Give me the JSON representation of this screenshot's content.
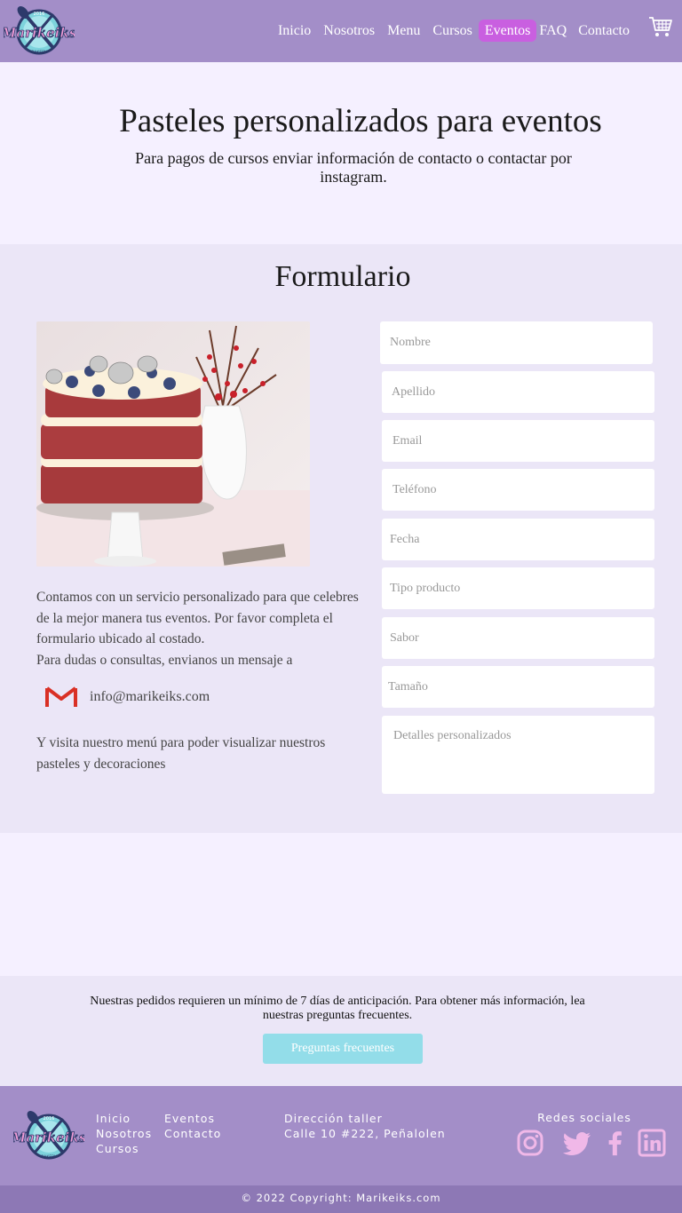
{
  "header": {
    "logo_text": "Marikeiks",
    "logo_year": "2016",
    "logo_sub": "BAKERY",
    "nav": [
      {
        "label": "Inicio",
        "active": false
      },
      {
        "label": "Nosotros",
        "active": false
      },
      {
        "label": "Menu",
        "active": false
      },
      {
        "label": "Cursos",
        "active": false
      },
      {
        "label": "Eventos",
        "active": true
      },
      {
        "label": "FAQ",
        "active": false
      },
      {
        "label": "Contacto",
        "active": false
      }
    ],
    "cart_icon": "shopping-cart-icon"
  },
  "hero": {
    "title": "Pasteles personalizados para eventos",
    "subtitle": "Para pagos de cursos enviar información de contacto o contactar por instagram."
  },
  "form_section": {
    "title": "Formulario",
    "info_text": "Contamos con un servicio personalizado para que celebres de la mejor manera tus eventos. Por favor completa el formulario ubicado al costado.",
    "info_text_2": "Para dudas o consultas, envianos un mensaje a",
    "email": "info@marikeiks.com",
    "menu_text": "Y visita nuestro menú para poder visualizar nuestros pasteles y decoraciones",
    "fields": {
      "nombre": "Nombre",
      "apellido": "Apellido",
      "email": "Email",
      "telefono": "Teléfono",
      "fecha": "Fecha",
      "tipo_producto": "Tipo producto",
      "sabor": "Sabor",
      "tamano": "Tamaño",
      "detalles": "Detalles personalizados"
    }
  },
  "notice": {
    "text": "Nuestras pedidos requieren un mínimo de 7 días de anticipación. Para obtener más información, lea nuestras preguntas frecuentes.",
    "button": "Preguntas frecuentes"
  },
  "footer": {
    "links_col1": [
      "Inicio",
      "Nosotros",
      "Cursos"
    ],
    "links_col2": [
      "Eventos",
      "Contacto"
    ],
    "address_title": "Dirección taller",
    "address": "Calle 10 #222, Peñalolen",
    "social_title": "Redes sociales",
    "social_icons": [
      "instagram-icon",
      "twitter-icon",
      "facebook-icon",
      "linkedin-icon"
    ],
    "copyright": "© 2022 Copyright: Marikeiks.com"
  },
  "colors": {
    "header_bg": "#a38ec8",
    "active_nav": "#c95fe0",
    "section_bg": "#ebe6f7",
    "page_bg": "#f5f0ff",
    "faq_button": "#93dde9",
    "social_icon": "#f0b8e8"
  }
}
